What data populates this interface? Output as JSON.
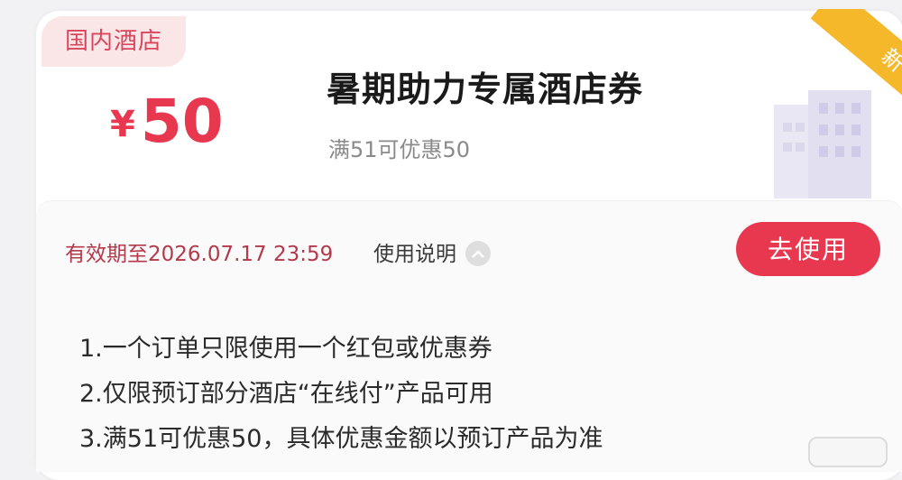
{
  "coupon": {
    "category_tag": "国内酒店",
    "new_badge": "新",
    "currency": "¥",
    "amount": "50",
    "title": "暑期助力专属酒店券",
    "subtitle": "满51可优惠50",
    "validity": "有效期至2026.07.17 23:59",
    "usage_link_label": "使用说明",
    "use_button_label": "去使用"
  },
  "rules": [
    "1.一个订单只限使用一个红包或优惠券",
    "2.仅限预订部分酒店“在线付”产品可用",
    "3.满51可优惠50，具体优惠金额以预订产品为准"
  ],
  "colors": {
    "accent": "#e8384f",
    "tag_bg": "#fbe6e7",
    "ribbon": "#f6b82b"
  },
  "icons": [
    "hotel-building-icon",
    "chevron-up-icon"
  ]
}
